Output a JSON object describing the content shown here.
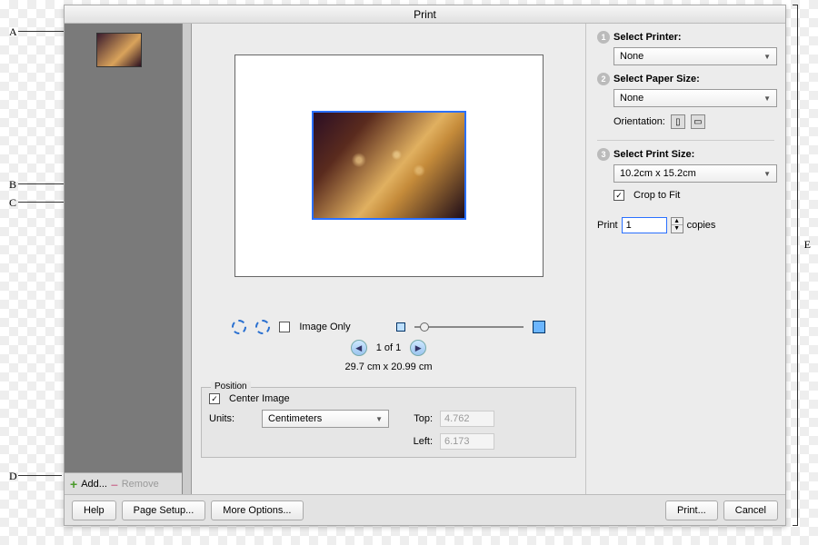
{
  "window": {
    "title": "Print"
  },
  "annotations": {
    "A": "A",
    "B": "B",
    "C": "C",
    "D": "D",
    "E": "E"
  },
  "projectBin": {
    "add": "Add...",
    "remove": "Remove"
  },
  "preview": {
    "imageOnly": "Image Only",
    "pager": "1 of 1",
    "paperDims": "29.7 cm x 20.99 cm"
  },
  "position": {
    "legend": "Position",
    "center": "Center Image",
    "unitsLabel": "Units:",
    "units": "Centimeters",
    "topLabel": "Top:",
    "top": "4.762",
    "leftLabel": "Left:",
    "left": "6.173"
  },
  "printer": {
    "step1": "Select Printer:",
    "step1val": "None",
    "step2": "Select Paper Size:",
    "step2val": "None",
    "orientLabel": "Orientation:",
    "step3": "Select Print Size:",
    "step3val": "10.2cm x 15.2cm",
    "crop": "Crop to Fit",
    "printWord": "Print",
    "copies": "1",
    "copiesWord": "copies"
  },
  "footer": {
    "help": "Help",
    "pageSetup": "Page Setup...",
    "moreOptions": "More Options...",
    "print": "Print...",
    "cancel": "Cancel"
  }
}
